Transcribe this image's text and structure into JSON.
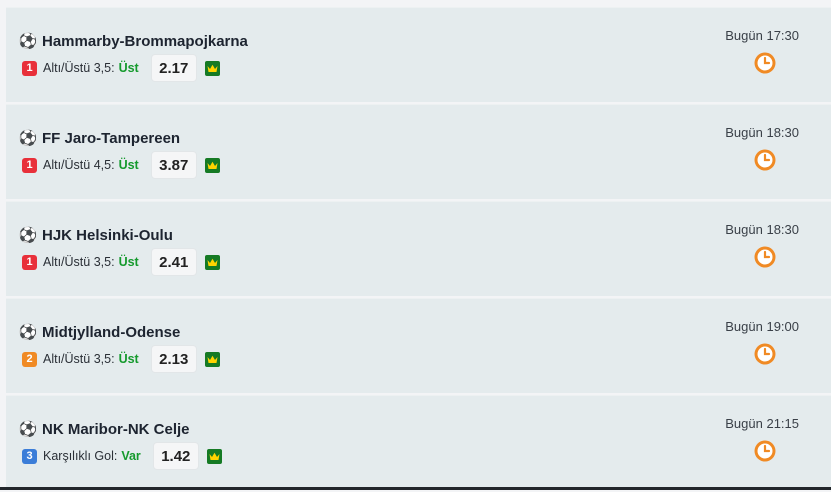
{
  "colors": {
    "card_bg": "#e4ebed",
    "pick_green": "#159a2d",
    "clock_orange": "#f08a24",
    "crown_green": "#157a24"
  },
  "matches": [
    {
      "teams": "Hammarby-Brommapojkarna",
      "badge": "1",
      "badge_color": "#e8303a",
      "market": "Altı/Üstü 3,5:",
      "pick": "Üst",
      "odds": "2.17",
      "time": "Bugün 17:30",
      "icon": "soccer-ball-icon"
    },
    {
      "teams": "FF Jaro-Tampereen",
      "badge": "1",
      "badge_color": "#e8303a",
      "market": "Altı/Üstü 4,5:",
      "pick": "Üst",
      "odds": "3.87",
      "time": "Bugün 18:30",
      "icon": "soccer-ball-icon"
    },
    {
      "teams": "HJK Helsinki-Oulu",
      "badge": "1",
      "badge_color": "#e8303a",
      "market": "Altı/Üstü 3,5:",
      "pick": "Üst",
      "odds": "2.41",
      "time": "Bugün 18:30",
      "icon": "soccer-ball-icon"
    },
    {
      "teams": "Midtjylland-Odense",
      "badge": "2",
      "badge_color": "#f08a24",
      "market": "Altı/Üstü 3,5:",
      "pick": "Üst",
      "odds": "2.13",
      "time": "Bugün 19:00",
      "icon": "soccer-ball-icon"
    },
    {
      "teams": "NK Maribor-NK Celje",
      "badge": "3",
      "badge_color": "#3b7dd8",
      "market": "Karşılıklı Gol:",
      "pick": "Var",
      "odds": "1.42",
      "time": "Bugün 21:15",
      "icon": "soccer-ball-icon"
    }
  ]
}
